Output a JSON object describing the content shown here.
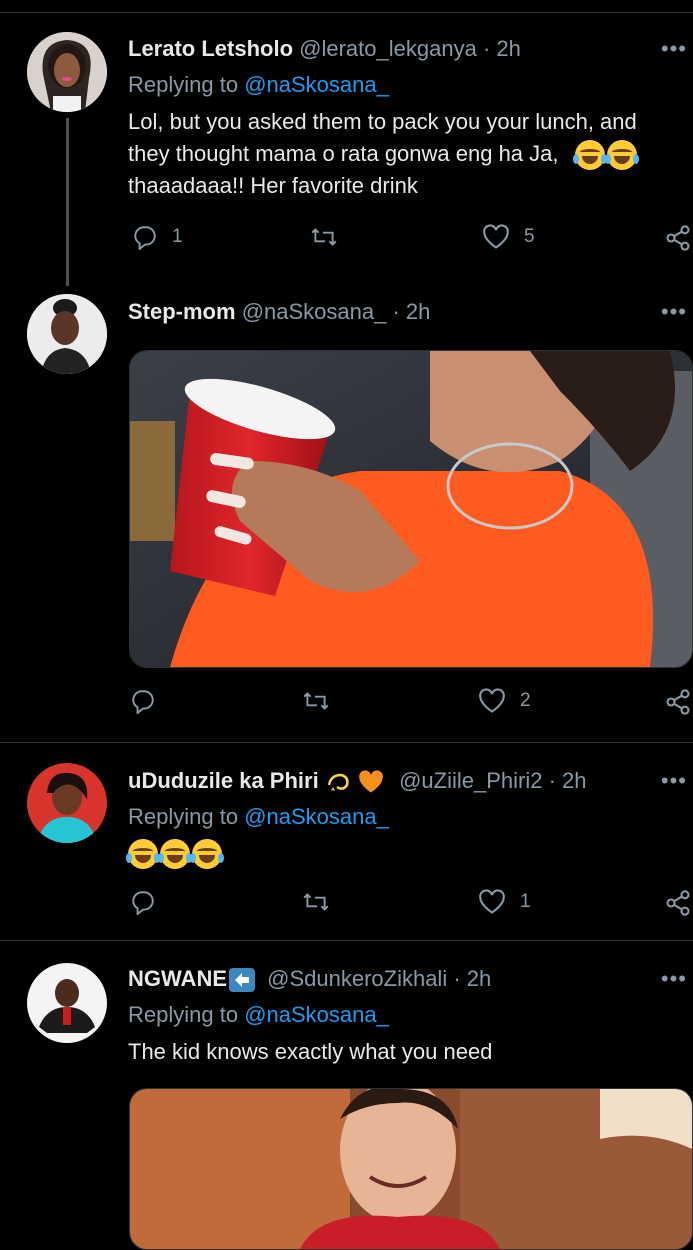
{
  "tweets": [
    {
      "name": "Lerato Letsholo",
      "handle": "@lerato_lekganya",
      "time": "· 2h",
      "replying_prefix": "Replying to ",
      "replying_to": "@naSkosana_",
      "text_lines": [
        "Lol,  but you asked them to pack you your lunch, and",
        "they thought mama o rata gonwa eng ha Ja,",
        "thaaadaaa!! Her favorite drink"
      ],
      "reply_count": "1",
      "retweet_count": "",
      "like_count": "5"
    },
    {
      "name": "Step-mom",
      "handle": "@naSkosana_",
      "time": "· 2h",
      "reply_count": "",
      "retweet_count": "",
      "like_count": "2"
    },
    {
      "name": "uDuduzile ka Phiri",
      "handle": "@uZiile_Phiri2",
      "time": "· 2h",
      "replying_prefix": "Replying to ",
      "replying_to": "@naSkosana_",
      "reply_count": "",
      "retweet_count": "",
      "like_count": "1"
    },
    {
      "name": "NGWANE",
      "handle": "@SdunkeroZikhali",
      "time": "· 2h",
      "replying_prefix": "Replying to ",
      "replying_to": "@naSkosana_",
      "text": "The kid knows exactly  what you need"
    }
  ],
  "more_label": "•••",
  "icons": [
    "reply-icon",
    "retweet-icon",
    "like-icon",
    "share-icon",
    "more-icon",
    "laughing-tears-emoji",
    "dizzy-emoji",
    "orange-heart-emoji",
    "left-arrow-emoji"
  ],
  "colors": {
    "background": "#000000",
    "link": "#1d9bf0",
    "secondary": "#8b98a5",
    "divider": "#2f3336"
  }
}
